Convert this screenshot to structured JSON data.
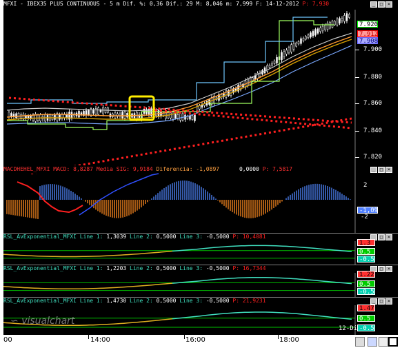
{
  "price_panel": {
    "symbol": "MFXI",
    "title_segments": [
      "MFXI - IBEX35 PLUS CONTINUOUS - 5 m Dif. %: 0,36 Dif.: 29 M: 8,046 m: 7,999 F: 14-12-2012 ",
      "P: 7,930"
    ],
    "y_ticks": [
      "7.900",
      "7.880",
      "7.860",
      "7.840",
      "7.820"
    ],
    "last_tags": [
      {
        "text": "7.920",
        "bg": "#ffffff",
        "fg": "#000000",
        "border": "#00ff00"
      },
      {
        "text": "7.912",
        "bg": "#ff9999",
        "fg": "#cc0000",
        "border": "#ff0000"
      },
      {
        "text": "7.908",
        "bg": "#aaaaff",
        "fg": "#000080",
        "border": "#6666ff"
      }
    ]
  },
  "macd_panel": {
    "label_parts": [
      {
        "text": "MACDHEHEL_MFXI MACD: 8,8287 ",
        "color": "#ff3030"
      },
      {
        "text": "Media SIG: 9,9184 ",
        "color": "#ff3030"
      },
      {
        "text": "Diferencia: -1,0897",
        "color": "#ffa040"
      },
      {
        "text": "      0,0000 ",
        "color": "#ffffff"
      },
      {
        "text": "P: 7,5817",
        "color": "#ff3030"
      }
    ],
    "y_ticks": [
      "2",
      "-2"
    ],
    "tag": "-1,09"
  },
  "rsl_panels": [
    {
      "name": "RSL_AvExponential_MFXI",
      "line1": "1,3039",
      "line2": "0,5000",
      "line3": "-0,5000",
      "p": "10,4081",
      "tags": [
        "1.3",
        "0.5",
        "-0.5"
      ]
    },
    {
      "name": "RSL_AvExponential_MFXI",
      "line1": "1,2203",
      "line2": "0,5000",
      "line3": "-0,5000",
      "p": "16,7344",
      "tags": [
        "1.22",
        "0.5",
        "-0.5"
      ]
    },
    {
      "name": "RSL_AvExponential_MFXI",
      "line1": "1,4730",
      "line2": "0,5000",
      "line3": "-0,5000",
      "p": "21,9231",
      "tags": [
        "1.47",
        "0.5",
        "-0.5"
      ]
    }
  ],
  "watermark": "visualchart",
  "date_label": "12-Di",
  "time_axis": [
    "00",
    "14:00",
    "16:00",
    "18:00"
  ],
  "colors": {
    "background": "#000000",
    "annotation_red": "#ff2020",
    "highlight_box": "#ffee00",
    "candle": "#e8e8e8",
    "rsl_line": "#40e0c0",
    "rsl_low": "#e0b020"
  }
}
